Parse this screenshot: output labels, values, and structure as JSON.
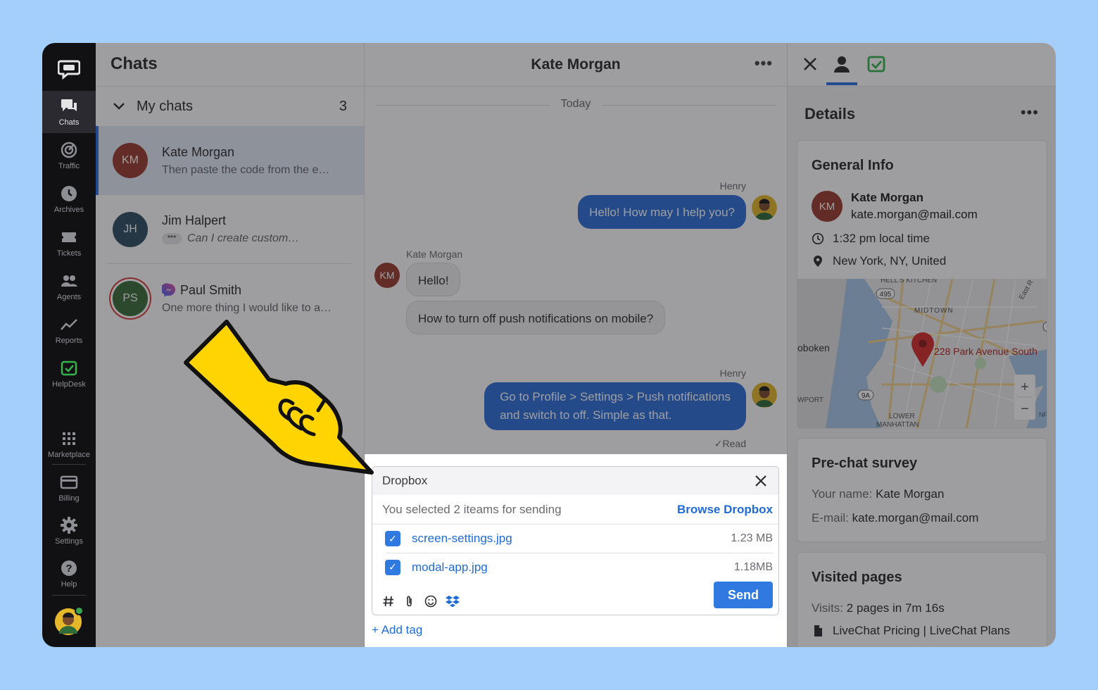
{
  "nav": {
    "items": [
      {
        "label": "Chats",
        "icon": "chats-icon"
      },
      {
        "label": "Traffic",
        "icon": "traffic-icon"
      },
      {
        "label": "Archives",
        "icon": "archives-icon"
      },
      {
        "label": "Tickets",
        "icon": "tickets-icon"
      },
      {
        "label": "Agents",
        "icon": "agents-icon"
      },
      {
        "label": "Reports",
        "icon": "reports-icon"
      },
      {
        "label": "HelpDesk",
        "icon": "helpdesk-icon"
      }
    ],
    "bottom": [
      {
        "label": "Marketplace",
        "icon": "marketplace-icon"
      },
      {
        "label": "Billing",
        "icon": "billing-icon"
      },
      {
        "label": "Settings",
        "icon": "settings-icon"
      },
      {
        "label": "Help",
        "icon": "help-icon"
      }
    ]
  },
  "list": {
    "title": "Chats",
    "group_label": "My chats",
    "group_count": "3",
    "chats": [
      {
        "initials": "KM",
        "name": "Kate Morgan",
        "preview": "Then paste the code from the e…",
        "color": "#9b3b2d"
      },
      {
        "initials": "JH",
        "name": "Jim Halpert",
        "preview": "Can I create custom…",
        "color": "#2f4f62"
      },
      {
        "initials": "PS",
        "name": "Paul Smith",
        "preview": "One more thing I would like to a…",
        "color": "#3c6b3a"
      }
    ]
  },
  "conversation": {
    "title": "Kate Morgan",
    "day": "Today",
    "messages": [
      {
        "sender": "Henry",
        "text": "Hello! How may I help you?"
      },
      {
        "sender": "Kate Morgan",
        "initials": "KM",
        "text": "Hello!"
      },
      {
        "text": "How to turn off push notifications on mobile?"
      },
      {
        "sender": "Henry",
        "text1": "Go to Profile > Settings > Push notifications",
        "text2": "and switch to off. Simple as that."
      }
    ],
    "read": "Read"
  },
  "dropbox": {
    "title": "Dropbox",
    "subtitle": "You selected 2 iteams for sending",
    "browse": "Browse Dropbox",
    "files": [
      {
        "name": "screen-settings.jpg",
        "size": "1.23 MB"
      },
      {
        "name": "modal-app.jpg",
        "size": "1.18MB"
      }
    ],
    "send": "Send",
    "add_tag": "+ Add tag"
  },
  "details": {
    "title": "Details",
    "general_title": "General Info",
    "initials": "KM",
    "name": "Kate Morgan",
    "email": "kate.morgan@mail.com",
    "local_time": "1:32 pm local time",
    "location": "New York, NY, United",
    "map_labels": {
      "kitchen": "HELL'S KITCHEN",
      "midtown": "MIDTOWN",
      "hoboken": "oboken",
      "address": "228 Park Avenue South",
      "port": "WPORT",
      "lower": "LOWER",
      "manhattan": "MANHATTAN",
      "east": "East R",
      "r495": "495",
      "r9a": "9A",
      "nf": "NF"
    },
    "zoom_in": "+",
    "zoom_out": "−",
    "survey_title": "Pre-chat survey",
    "survey_name_label": "Your name:",
    "survey_name": "Kate Morgan",
    "survey_email_label": "E-mail:",
    "survey_email": "kate.morgan@mail.com",
    "visited_title": "Visited pages",
    "visits_label": "Visits:",
    "visits_value": "2 pages in 7m 16s",
    "page": "LiveChat Pricing | LiveChat Plans"
  },
  "colors": {
    "accent": "#2e6fd9",
    "pointer": "#ffd400",
    "background": "#a4cffc"
  }
}
